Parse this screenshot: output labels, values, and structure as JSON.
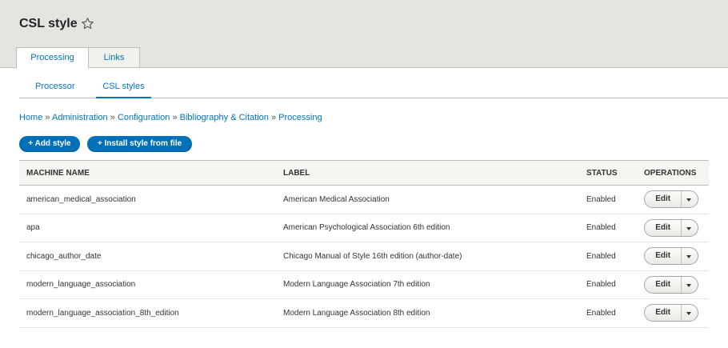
{
  "header": {
    "title": "CSL style"
  },
  "primary_tabs": [
    {
      "label": "Processing"
    },
    {
      "label": "Links"
    }
  ],
  "secondary_tabs": [
    {
      "label": "Processor"
    },
    {
      "label": "CSL styles"
    }
  ],
  "breadcrumb": [
    "Home",
    "Administration",
    "Configuration",
    "Bibliography & Citation",
    "Processing"
  ],
  "breadcrumb_separator": "»",
  "actions": {
    "add_style": "+ Add style",
    "install_style": "+ Install style from file"
  },
  "table": {
    "headers": {
      "machine_name": "MACHINE NAME",
      "label": "LABEL",
      "status": "STATUS",
      "operations": "OPERATIONS"
    },
    "rows": [
      {
        "machine_name": "american_medical_association",
        "label": "American Medical Association",
        "status": "Enabled",
        "op": "Edit"
      },
      {
        "machine_name": "apa",
        "label": "American Psychological Association 6th edition",
        "status": "Enabled",
        "op": "Edit"
      },
      {
        "machine_name": "chicago_author_date",
        "label": "Chicago Manual of Style 16th edition (author-date)",
        "status": "Enabled",
        "op": "Edit"
      },
      {
        "machine_name": "modern_language_association",
        "label": "Modern Language Association 7th edition",
        "status": "Enabled",
        "op": "Edit"
      },
      {
        "machine_name": "modern_language_association_8th_edition",
        "label": "Modern Language Association 8th edition",
        "status": "Enabled",
        "op": "Edit"
      }
    ]
  },
  "colors": {
    "link": "#0074bd",
    "primary_button": "#0071b8",
    "header_bg": "#e6e4df"
  },
  "icons": {
    "favorite": "star-icon",
    "dropdown": "chevron-down-icon"
  }
}
